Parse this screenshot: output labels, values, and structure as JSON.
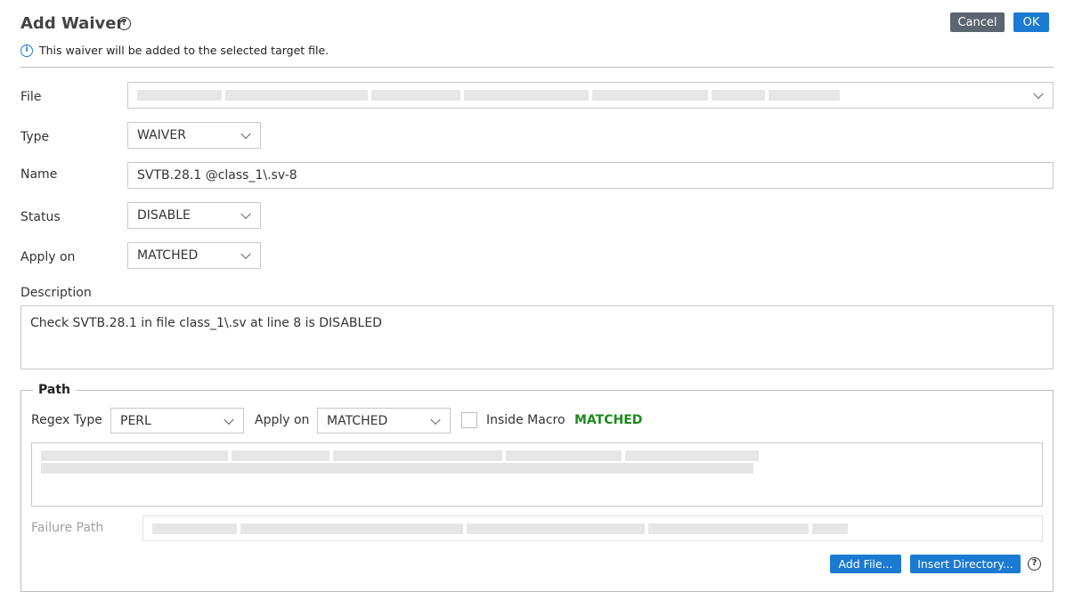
{
  "dialog": {
    "title": "Add Waiver",
    "cancel_label": "Cancel",
    "ok_label": "OK",
    "info_text": "This waiver will be added to the selected target file."
  },
  "form": {
    "file_label": "File",
    "type_label": "Type",
    "type_value": "WAIVER",
    "name_label": "Name",
    "name_value": "SVTB.28.1 @class_1\\.sv-8",
    "status_label": "Status",
    "status_value": "DISABLE",
    "apply_on_label": "Apply on",
    "apply_on_value": "MATCHED",
    "description_label": "Description",
    "description_value": "Check SVTB.28.1 in file class_1\\.sv at line 8 is DISABLED"
  },
  "path": {
    "legend": "Path",
    "regex_type_label": "Regex Type",
    "regex_type_value": "PERL",
    "apply_on_label": "Apply on",
    "apply_on_value": "MATCHED",
    "inside_macro_label": "Inside Macro",
    "inside_macro_checked": false,
    "match_status": "MATCHED",
    "failure_path_label": "Failure Path",
    "add_file_label": "Add File...",
    "insert_directory_label": "Insert Directory..."
  },
  "icons": {
    "help": "help-icon",
    "info": "info-icon",
    "dropdown": "chevron-down-icon"
  },
  "colors": {
    "primary": "#1b7ad2",
    "secondary_button": "#5b6670",
    "matched": "#1c8a1c"
  }
}
